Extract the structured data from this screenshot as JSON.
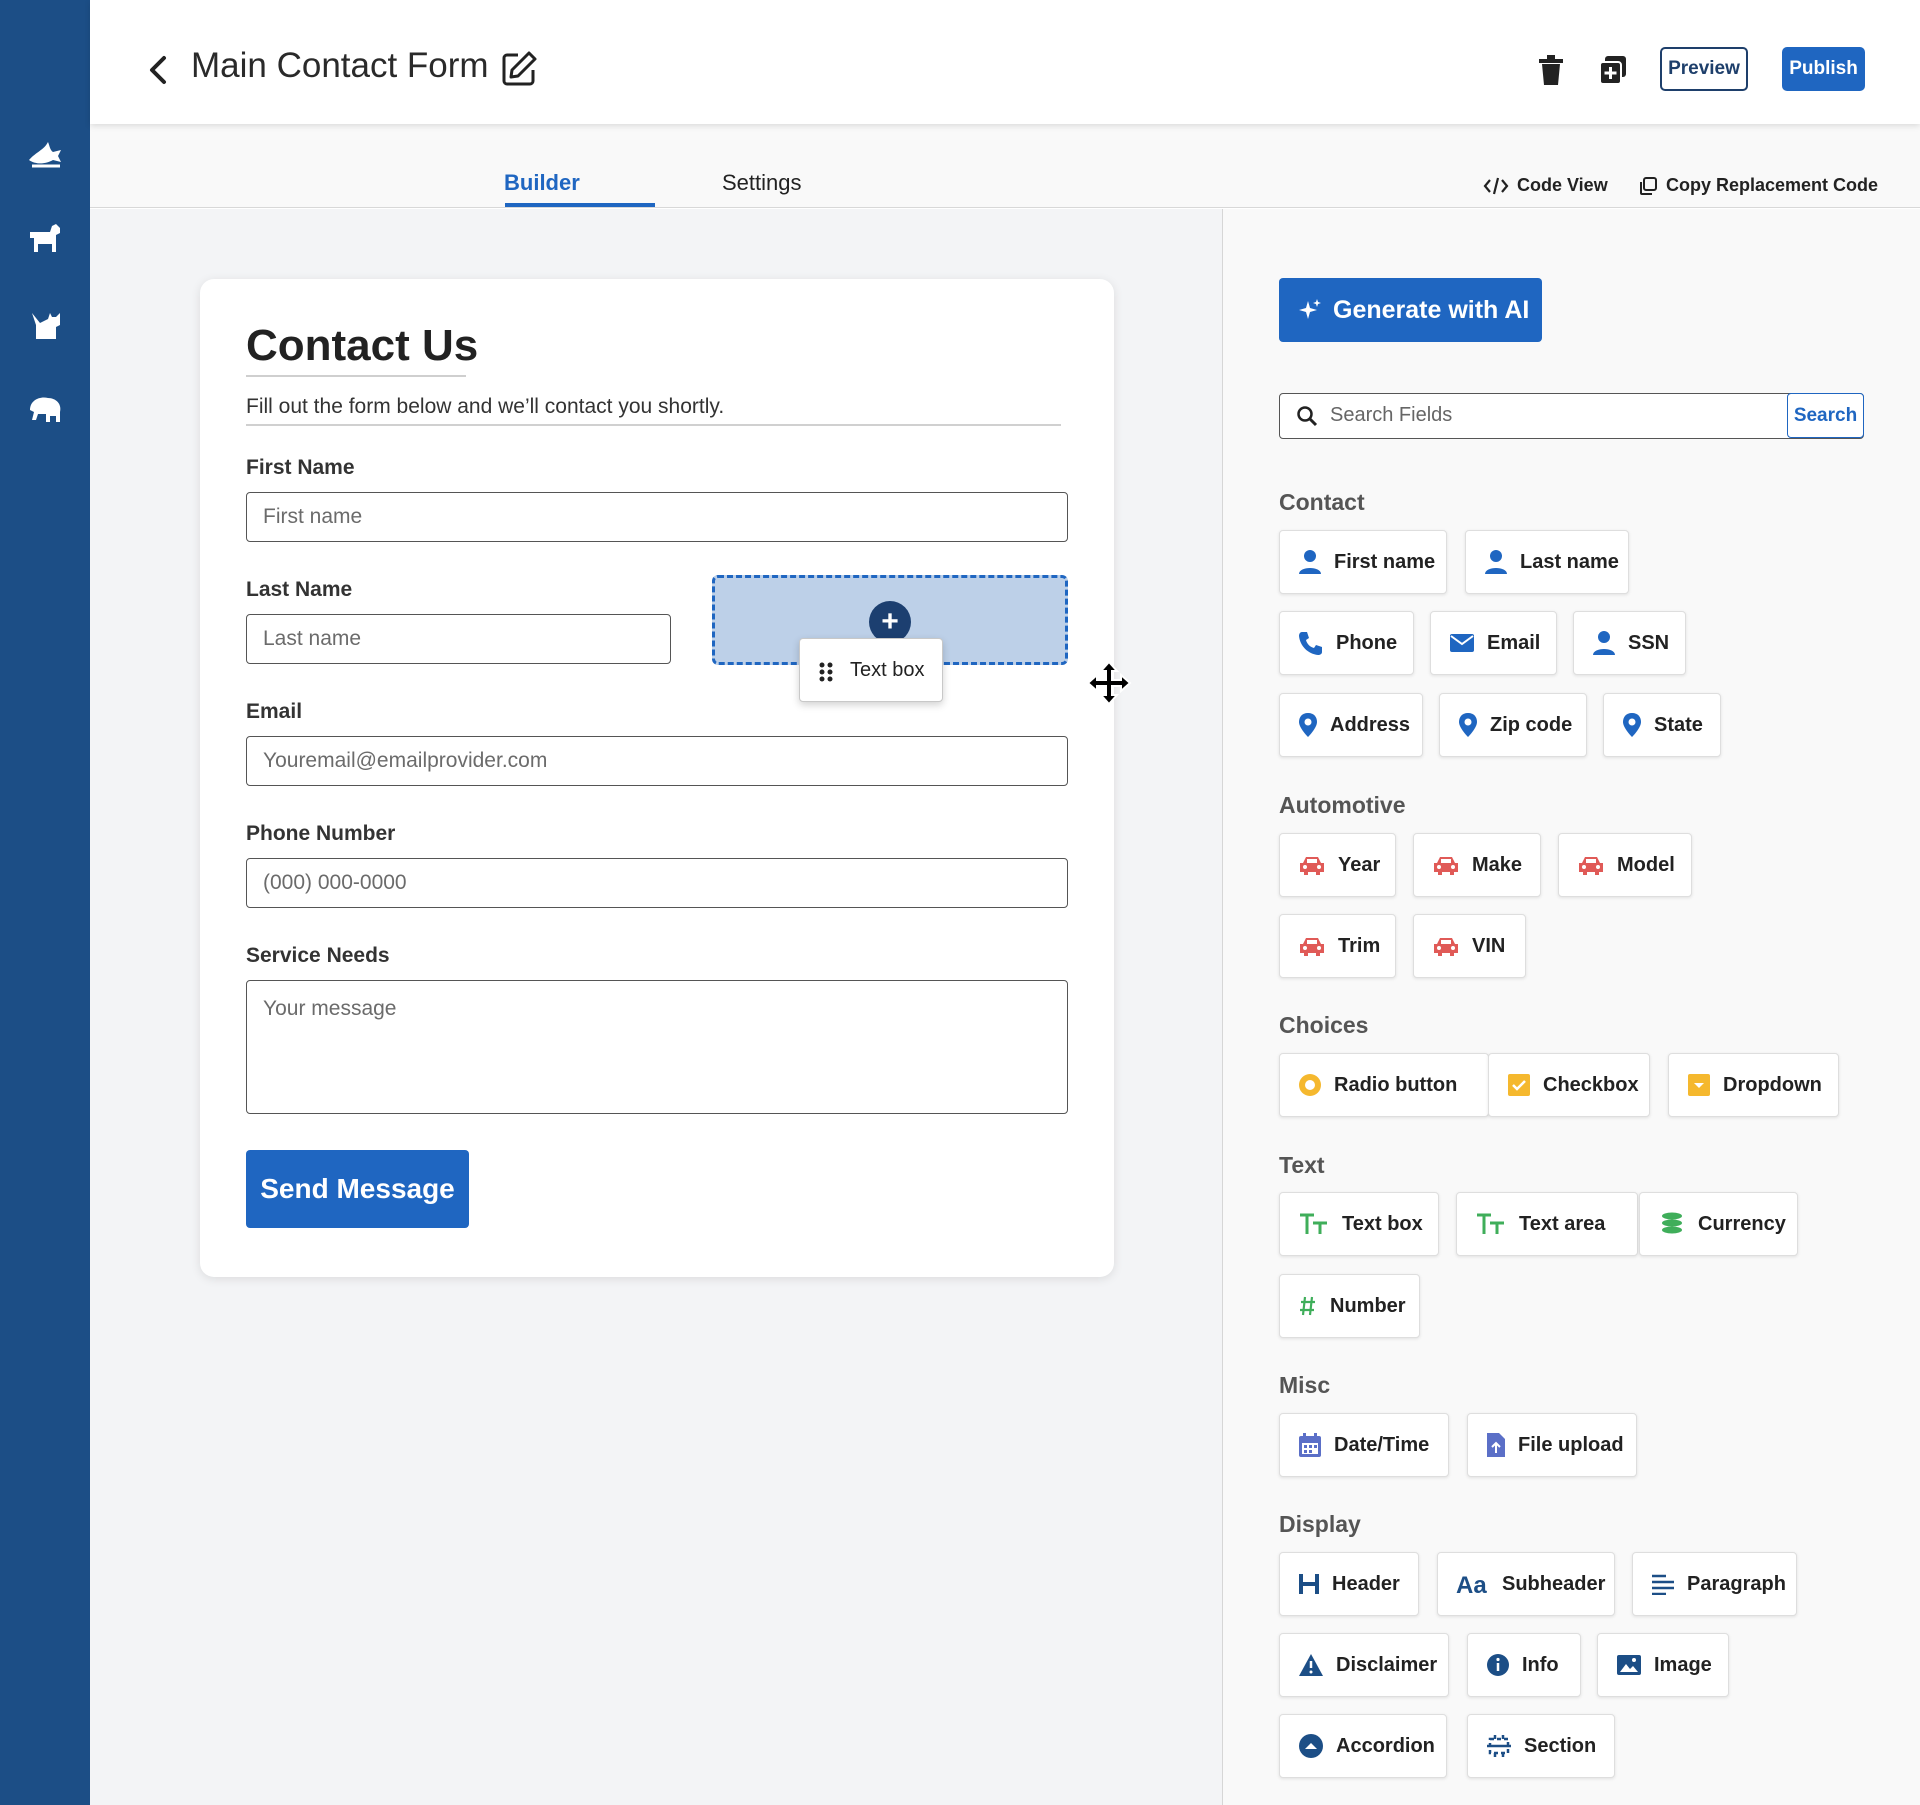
{
  "header": {
    "title": "Main Contact Form",
    "preview_label": "Preview",
    "publish_label": "Publish"
  },
  "tabs": {
    "builder": "Builder",
    "settings": "Settings",
    "active": "Builder"
  },
  "toolbar": {
    "code_view": "Code View",
    "copy_replacement_code": "Copy Replacement Code"
  },
  "form": {
    "title": "Contact Us",
    "subtitle": "Fill out the form below and we’ll contact you shortly.",
    "first_name_label": "First Name",
    "first_name_placeholder": "First name",
    "last_name_label": "Last Name",
    "last_name_placeholder": "Last name",
    "email_label": "Email",
    "email_placeholder": "Youremail@emailprovider.com",
    "phone_label": "Phone Number",
    "phone_placeholder": "(000) 000-0000",
    "service_label": "Service Needs",
    "service_placeholder": "Your message",
    "submit_label": "Send Message"
  },
  "drag": {
    "chip_label": "Text box",
    "drop_symbol": "+"
  },
  "panel": {
    "ai_button": "Generate with AI",
    "search_placeholder": "Search Fields",
    "search_button": "Search",
    "categories": {
      "contact": {
        "title": "Contact",
        "items": [
          "First name",
          "Last name",
          "Phone",
          "Email",
          "SSN",
          "Address",
          "Zip code",
          "State"
        ]
      },
      "automotive": {
        "title": "Automotive",
        "items": [
          "Year",
          "Make",
          "Model",
          "Trim",
          "VIN"
        ]
      },
      "choices": {
        "title": "Choices",
        "items": [
          "Radio button",
          "Checkbox",
          "Dropdown"
        ]
      },
      "text": {
        "title": "Text",
        "items": [
          "Text box",
          "Text area",
          "Currency",
          "Number"
        ]
      },
      "misc": {
        "title": "Misc",
        "items": [
          "Date/Time",
          "File upload"
        ]
      },
      "display": {
        "title": "Display",
        "items": [
          "Header",
          "Subheader",
          "Paragraph",
          "Disclaimer",
          "Info",
          "Image",
          "Accordion",
          "Section"
        ]
      }
    }
  },
  "colors": {
    "sidebar": "#1c4e86",
    "primary": "#1f66c1",
    "contact_icon": "#1f66c1",
    "automotive_icon": "#e05a57",
    "choices_icon": "#f5b82e",
    "text_icon": "#3fae5a",
    "misc_icon": "#5b6fc7",
    "display_icon": "#1c4e86"
  }
}
